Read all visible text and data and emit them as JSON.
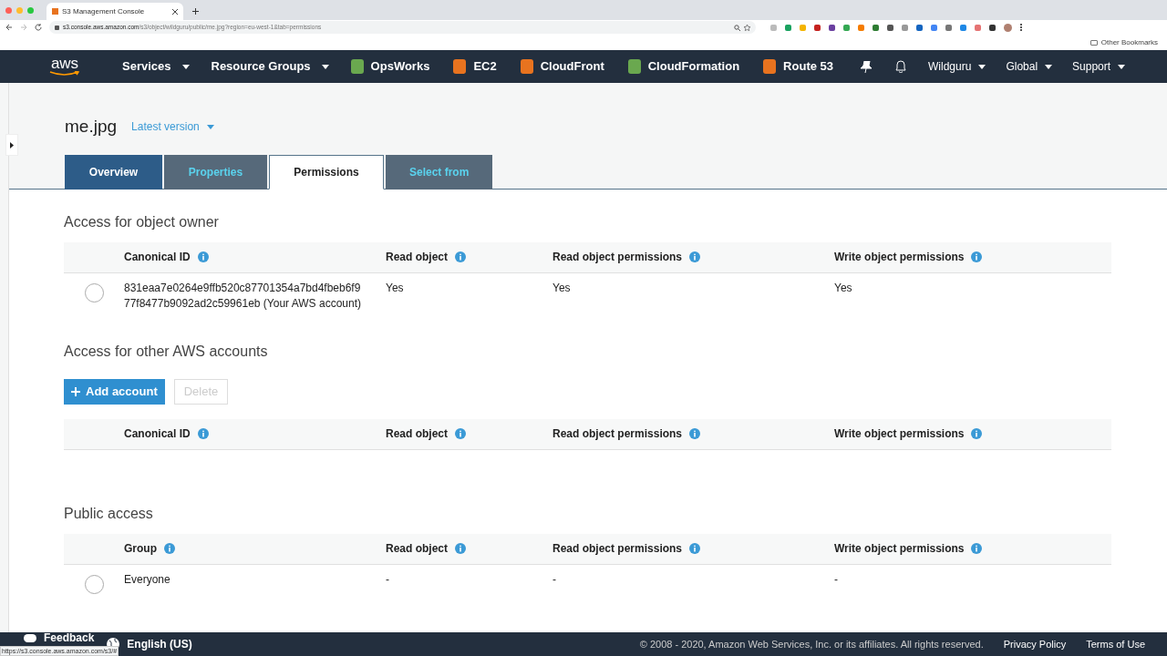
{
  "browser": {
    "tab_title": "S3 Management Console",
    "url_host": "s3.console.aws.amazon.com",
    "url_path": "/s3/object/wildguru/public/me.jpg?region=eu-west-1&tab=permissions",
    "bookmarks": "Other Bookmarks",
    "status_url": "https://s3.console.aws.amazon.com/s3/#"
  },
  "nav": {
    "logo": "aws",
    "menus": [
      "Services",
      "Resource Groups"
    ],
    "services": [
      {
        "name": "OpsWorks",
        "color": "#6aa84f"
      },
      {
        "name": "EC2",
        "color": "#e8731f"
      },
      {
        "name": "CloudFront",
        "color": "#e8731f"
      },
      {
        "name": "CloudFormation",
        "color": "#6aa84f"
      },
      {
        "name": "Route 53",
        "color": "#e8731f"
      }
    ],
    "right_menus": [
      "Wildguru",
      "Global",
      "Support"
    ]
  },
  "object": {
    "name": "me.jpg",
    "version": "Latest version"
  },
  "tabs": [
    {
      "label": "Overview",
      "selected": false,
      "hovered": true
    },
    {
      "label": "Properties",
      "selected": false,
      "hovered": false
    },
    {
      "label": "Permissions",
      "selected": true,
      "hovered": false
    },
    {
      "label": "Select from",
      "selected": false,
      "hovered": false
    }
  ],
  "sections": [
    {
      "title": "Access for object owner",
      "columns": [
        "Canonical ID",
        "Read object",
        "Read object permissions",
        "Write object permissions"
      ],
      "rows": [
        {
          "selected": false,
          "cells": [
            "831eaa7e0264e9ffb520c87701354a7bd4fbeb6f9 77f8477b9092ad2c59961eb (Your AWS account)",
            "Yes",
            "Yes",
            "Yes"
          ]
        }
      ]
    },
    {
      "title": "Access for other AWS accounts",
      "buttons": [
        {
          "label": "Add account",
          "disabled": false
        },
        {
          "label": "Delete",
          "disabled": true
        }
      ],
      "columns": [
        "Canonical ID",
        "Read object",
        "Read object permissions",
        "Write object permissions"
      ]
    },
    {
      "title": "Public access",
      "columns": [
        "Group",
        "Read object",
        "Read object permissions",
        "Write object permissions"
      ],
      "rows": [
        {
          "selected": false,
          "cells": [
            "Everyone",
            "-",
            "-",
            "-"
          ]
        }
      ]
    }
  ],
  "footer": {
    "feedback": "Feedback",
    "language": "English (US)",
    "copyright": "© 2008 - 2020, Amazon Web Services, Inc. or its affiliates. All rights reserved.",
    "links": [
      "Privacy Policy",
      "Terms of Use"
    ]
  }
}
